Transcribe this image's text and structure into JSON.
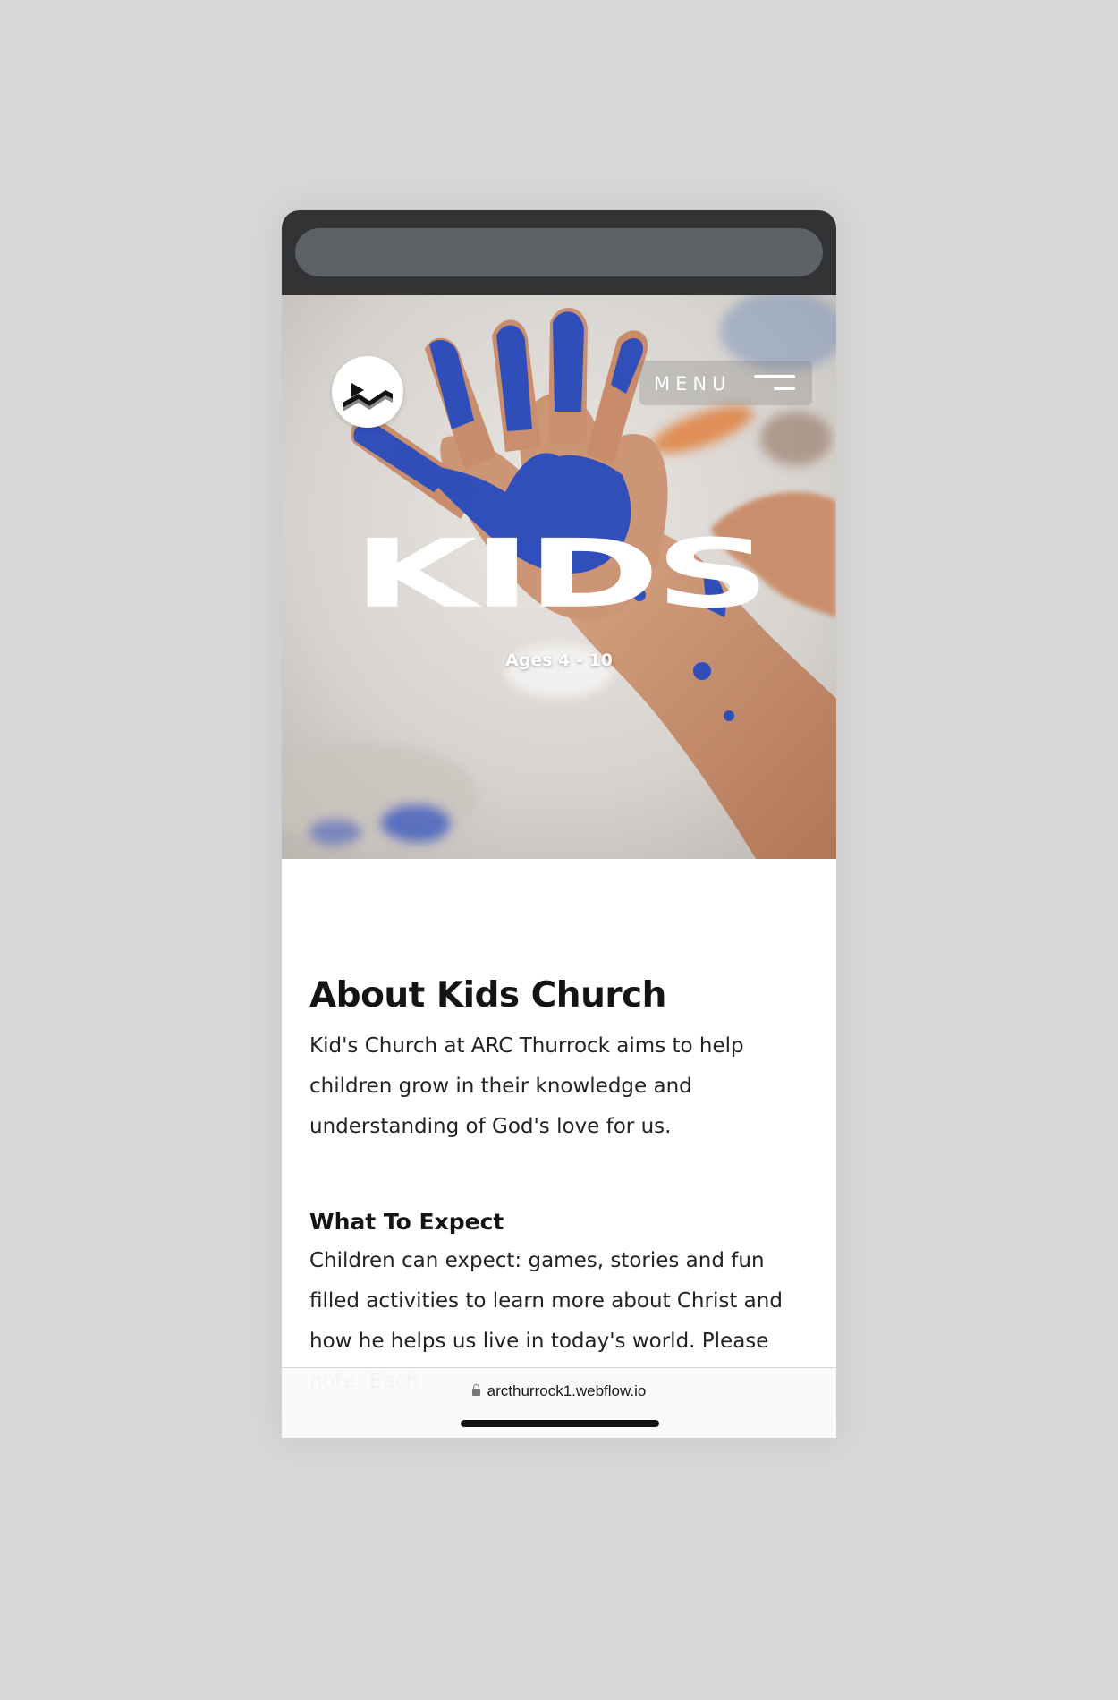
{
  "browser": {
    "url": "arcthurrock1.webflow.io"
  },
  "hero": {
    "menu_label": "MENU",
    "title": "KIDS",
    "subtitle": "Ages 4 - 10"
  },
  "about": {
    "heading": "About Kids Church",
    "body": "Kid's Church at ARC Thurrock aims to help children grow in their knowledge and understanding of God's love for us."
  },
  "expect": {
    "heading": "What To Expect",
    "body": "Children can expect: games, stories and fun filled activities to learn more about Christ and how he helps us live in today's world. Please note: Each"
  },
  "icons": {
    "logo": "arc-logo-icon",
    "menu": "hamburger-icon",
    "lock": "lock-icon"
  },
  "colors": {
    "page_background": "#d7d7d7",
    "browser_chrome": "#323335",
    "heading_text": "#141414",
    "body_text": "#222222",
    "paint_blue": "#2a4fc0"
  }
}
